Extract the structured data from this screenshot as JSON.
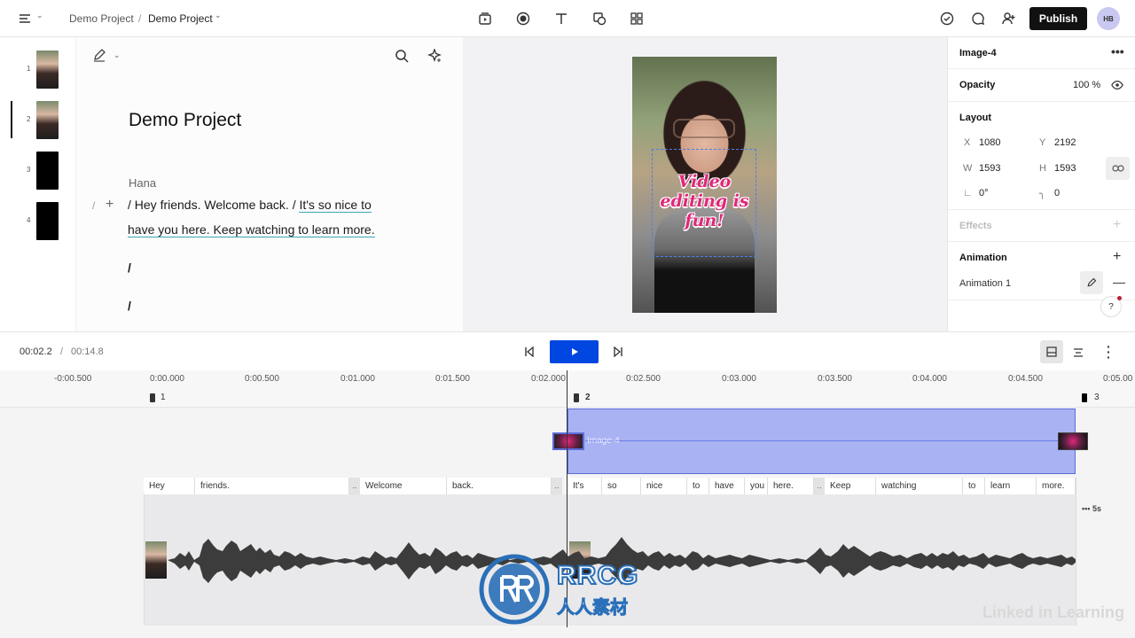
{
  "header": {
    "breadcrumb_root": "Demo Project",
    "breadcrumb_sep": "/",
    "breadcrumb_current": "Demo Project",
    "publish_label": "Publish",
    "avatar_initials": "HB"
  },
  "scenes": [
    {
      "num": "1"
    },
    {
      "num": "2"
    },
    {
      "num": "3"
    },
    {
      "num": "4"
    }
  ],
  "script": {
    "title": "Demo Project",
    "speaker": "Hana",
    "line1_a": "/ Hey friends. Welcome back. /",
    "line1_b": "It's so nice to",
    "line2": "have you here. Keep watching to learn more.",
    "slash1": "/",
    "slash2": "/",
    "gutter_slash": "/",
    "gutter_plus": "+"
  },
  "preview": {
    "caption": "Video editing is fun!"
  },
  "props": {
    "layer_name": "Image-4",
    "opacity_label": "Opacity",
    "opacity_value": "100 %",
    "layout_label": "Layout",
    "x_label": "X",
    "x_value": "1080",
    "y_label": "Y",
    "y_value": "2192",
    "w_label": "W",
    "w_value": "1593",
    "h_label": "H",
    "h_value": "1593",
    "rotation_value": "0°",
    "radius_value": "0",
    "effects_label": "Effects",
    "animation_label": "Animation",
    "animation_item": "Animation 1",
    "help": "?"
  },
  "transport": {
    "current": "00:02.2",
    "sep": "/",
    "total": "00:14.8"
  },
  "timeline": {
    "ticks": [
      "-0:00.500",
      "0:00.000",
      "0:00.500",
      "0:01.000",
      "0:01.500",
      "0:02.000",
      "0:02.500",
      "0:03.000",
      "0:03.500",
      "0:04.000",
      "0:04.500",
      "0:05.00"
    ],
    "scene_labels": [
      "1",
      "2",
      "3"
    ],
    "clip_label": "Image-4",
    "words": [
      "Hey",
      "friends.",
      "..",
      "Welcome",
      "back.",
      "..",
      "It's",
      "so",
      "nice",
      "to",
      "have",
      "you",
      "here.",
      "..",
      "Keep",
      "watching",
      "to",
      "learn",
      "more."
    ],
    "more_label": "••• 5s"
  },
  "watermark": {
    "brand": "RRCG",
    "sub": "人人素材",
    "linkedin": "Linked in Learning"
  },
  "colors": {
    "accent": "#0046e0",
    "clip": "#a9b2f3",
    "caption": "#e0287a"
  }
}
